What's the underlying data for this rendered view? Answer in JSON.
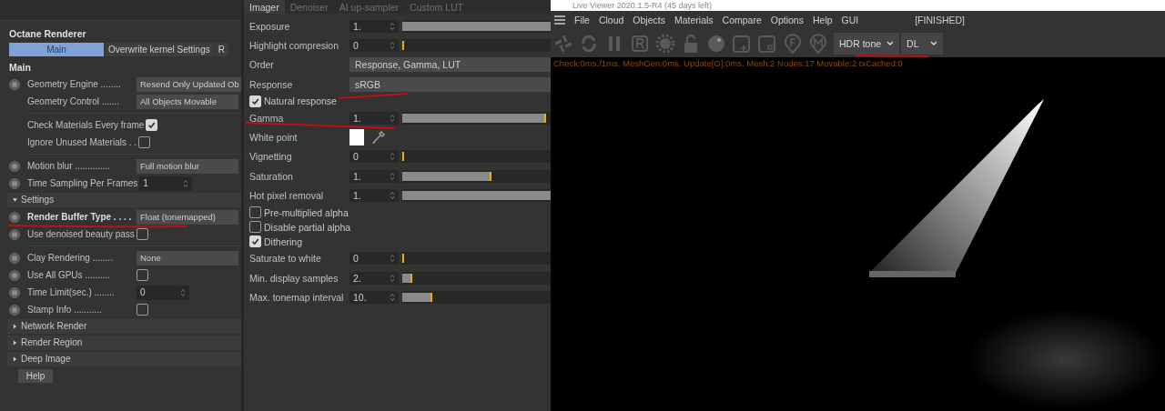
{
  "render_settings": {
    "title": "Octane Renderer",
    "tabs": [
      {
        "label": "Main",
        "selected": true
      },
      {
        "label": "Overwrite kernel Settings",
        "selected": false
      },
      {
        "label": "R",
        "selected": false
      }
    ],
    "section": "Main",
    "rows": [
      {
        "kind": "dropdown",
        "dot_icon": true,
        "label": "Geometry Engine ........",
        "value": "Resend Only Updated Ob"
      },
      {
        "kind": "dropdown",
        "dot_icon": false,
        "label": "Geometry Control .......",
        "value": "All Objects Movable"
      },
      {
        "kind": "divider"
      },
      {
        "kind": "checkbox",
        "dot_icon": false,
        "label": "Check Materials Every frame",
        "checked": true
      },
      {
        "kind": "checkbox",
        "dot_icon": false,
        "label": "Ignore Unused Materials . .",
        "checked": false
      },
      {
        "kind": "divider"
      },
      {
        "kind": "dropdown",
        "dot_icon": true,
        "label": "Motion blur ..............",
        "value": "Full motion blur"
      },
      {
        "kind": "spinner",
        "dot_icon": true,
        "label": "Time Sampling Per Frames",
        "value": "1"
      },
      {
        "kind": "group",
        "label": "Settings",
        "expanded": true
      },
      {
        "kind": "dropdown",
        "dot_icon": true,
        "bold": true,
        "label": "Render Buffer Type . . . .",
        "value": "Float (tonemapped)"
      },
      {
        "kind": "checkbox",
        "dot_icon": true,
        "label": "Use denoised beauty pass",
        "checked": false
      },
      {
        "kind": "divider"
      },
      {
        "kind": "dropdown",
        "dot_icon": true,
        "label": "Clay Rendering ........",
        "value": "None"
      },
      {
        "kind": "checkbox",
        "dot_icon": true,
        "label": "Use All GPUs ..........",
        "checked": false
      },
      {
        "kind": "spinner",
        "dot_icon": true,
        "label": "Time Limit(sec.) ........",
        "value": "0"
      },
      {
        "kind": "checkbox",
        "dot_icon": true,
        "label": "Stamp Info ...........",
        "checked": false
      },
      {
        "kind": "group",
        "label": "Network Render",
        "expanded": false
      },
      {
        "kind": "group",
        "label": "Render Region",
        "expanded": false
      },
      {
        "kind": "group",
        "label": "Deep Image",
        "expanded": false
      }
    ],
    "help_button": "Help"
  },
  "imager": {
    "tabs": [
      {
        "label": "Imager",
        "selected": true
      },
      {
        "label": "Denoiser",
        "selected": false
      },
      {
        "label": "AI up-sampler",
        "selected": false
      },
      {
        "label": "Custom LUT",
        "selected": false
      }
    ],
    "rows": [
      {
        "kind": "slider",
        "label": "Exposure",
        "value": "1.",
        "level": 1
      },
      {
        "kind": "slider",
        "label": "Highlight compresion",
        "value": "0",
        "level": 0
      },
      {
        "kind": "dropdown",
        "label": "Order",
        "value": "Response, Gamma, LUT"
      },
      {
        "kind": "dropdown",
        "label": "Response",
        "value": "sRGB"
      },
      {
        "kind": "checkbox",
        "label": "Natural response",
        "checked": true
      },
      {
        "kind": "slider",
        "label": "Gamma",
        "value": "1.",
        "level": 0.97
      },
      {
        "kind": "color",
        "label": "White point",
        "color": "#ffffff"
      },
      {
        "kind": "slider",
        "label": "Vignetting",
        "value": "0",
        "level": 0
      },
      {
        "kind": "slider",
        "label": "Saturation",
        "value": "1.",
        "level": 0.6
      },
      {
        "kind": "slider",
        "label": "Hot pixel removal",
        "value": "1.",
        "level": 1
      },
      {
        "kind": "checkbox",
        "label": "Pre-multiplied alpha",
        "checked": false
      },
      {
        "kind": "checkbox",
        "label": "Disable partial alpha",
        "checked": false
      },
      {
        "kind": "checkbox",
        "label": "Dithering",
        "checked": true
      },
      {
        "kind": "slider",
        "label": "Saturate to white",
        "value": "0",
        "level": 0
      },
      {
        "kind": "slider",
        "label": "Min. display samples",
        "value": "2.",
        "level": 0.07
      },
      {
        "kind": "slider",
        "label": "Max. tonemap interval",
        "value": "10.",
        "level": 0.2
      }
    ]
  },
  "live_viewer": {
    "title": "Live Viewer 2020.1.5-R4 (45 days left)",
    "menu": [
      "File",
      "Cloud",
      "Objects",
      "Materials",
      "Compare",
      "Options",
      "Help",
      "GUI"
    ],
    "status": "[FINISHED]",
    "dropdowns": [
      "HDR tone",
      "DL"
    ],
    "stats": "Check:0ms./1ms. MeshGen:0ms. Update[G]:0ms. Mesh:2 Nodes:17 Movable:2 txCached:0"
  }
}
